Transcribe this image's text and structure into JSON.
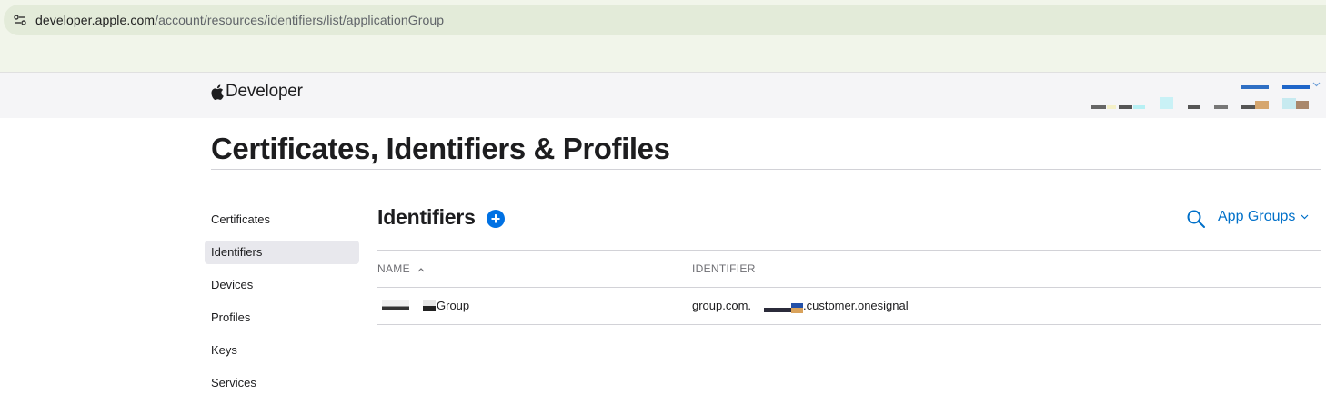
{
  "browser": {
    "url_domain": "developer.apple.com",
    "url_path": "/account/resources/identifiers/list/applicationGroup"
  },
  "header": {
    "logo_text": "Developer"
  },
  "page": {
    "title": "Certificates, Identifiers & Profiles"
  },
  "sidebar": {
    "items": [
      {
        "label": "Certificates",
        "active": false
      },
      {
        "label": "Identifiers",
        "active": true
      },
      {
        "label": "Devices",
        "active": false
      },
      {
        "label": "Profiles",
        "active": false
      },
      {
        "label": "Keys",
        "active": false
      },
      {
        "label": "Services",
        "active": false
      }
    ]
  },
  "main": {
    "section_title": "Identifiers",
    "add_label": "+",
    "filter_label": "App Groups",
    "columns": {
      "name": "NAME",
      "identifier": "IDENTIFIER"
    },
    "rows": [
      {
        "name_suffix": "Group",
        "identifier_prefix": "group.com.",
        "identifier_suffix": ".customer.onesignal"
      }
    ]
  },
  "colors": {
    "accent": "#0071e3",
    "link": "#0070c9"
  }
}
